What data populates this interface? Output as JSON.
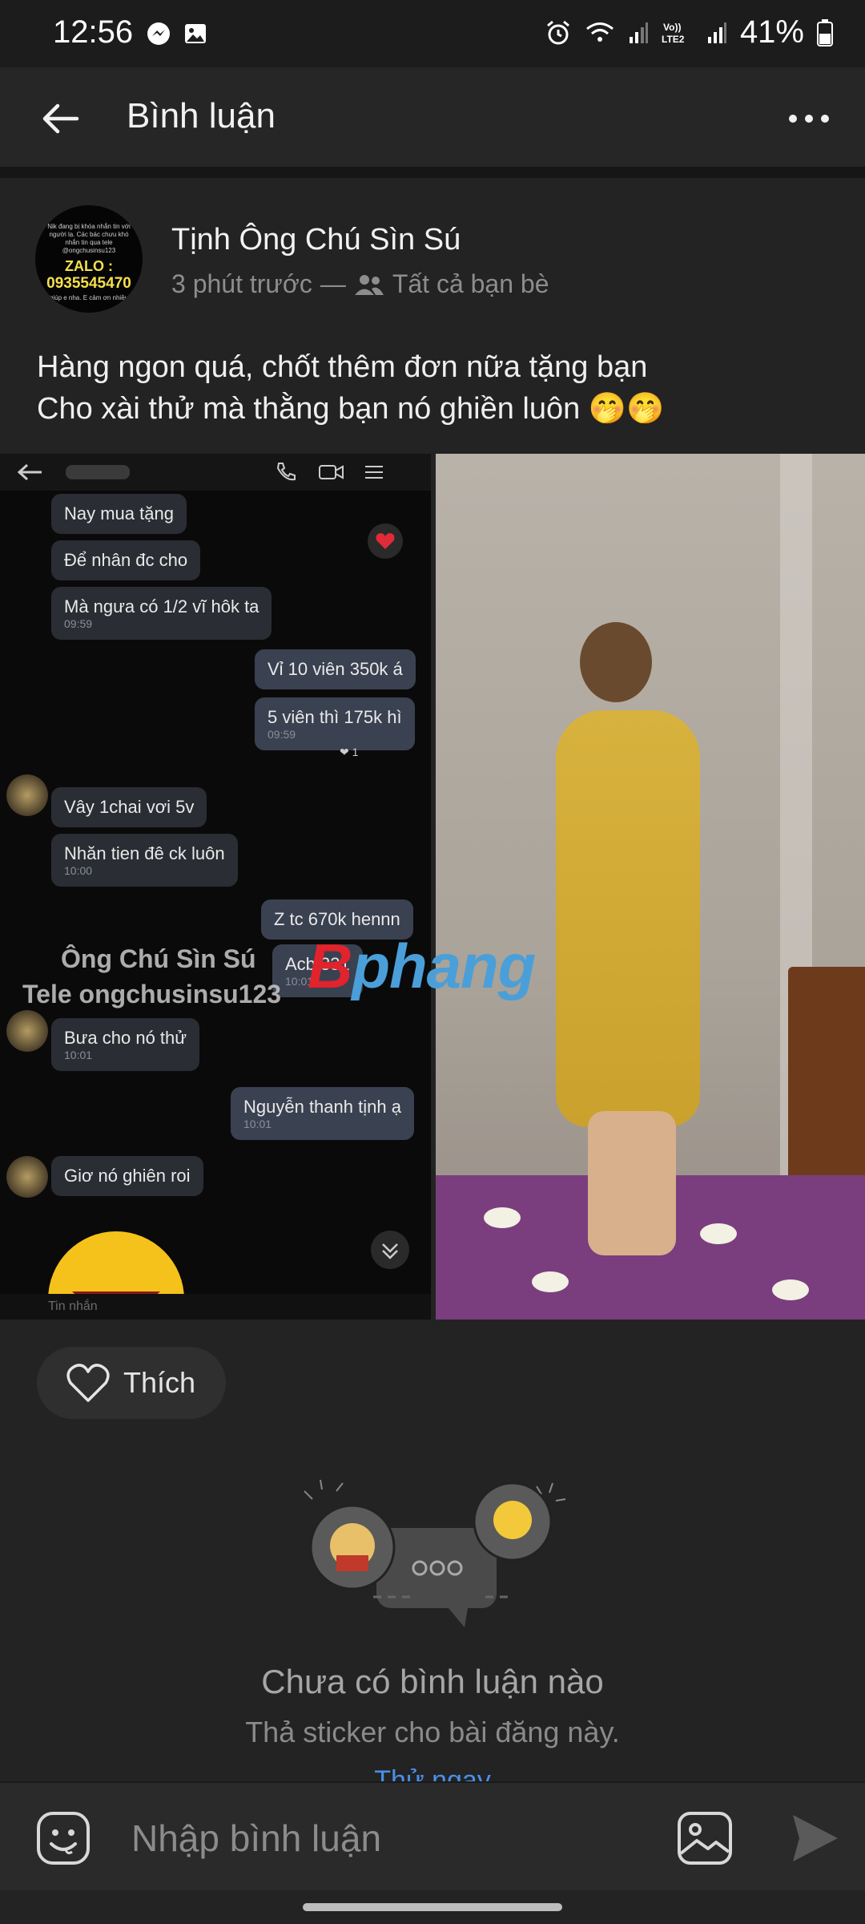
{
  "status_bar": {
    "time": "12:56",
    "battery": "41%",
    "icons": [
      "messenger-icon",
      "gallery-icon",
      "alarm-icon",
      "wifi-icon",
      "signal-icon",
      "volte-icon",
      "signal-icon",
      "battery-icon"
    ]
  },
  "appbar": {
    "title": "Bình luận"
  },
  "post": {
    "author": "Tịnh Ông Chú Sìn Sú",
    "time": "3 phút trước",
    "separator": "—",
    "audience": "Tất cả bạn bè",
    "text_line1": "Hàng ngon quá, chốt thêm đơn nữa tặng bạn",
    "text_line2": "Cho xài thử mà thằng bạn nó ghiền luôn 🤭🤭",
    "avatar": {
      "small_text": "Nik đang bị khóa nhắn tin với người lạ. Các bác chưu khó nhắn tin qua tele @ongchusinsu123",
      "zalo_label": "ZALO :",
      "phone": "0935545470",
      "footer": "giúp e nha. E cảm ơn nhiều"
    }
  },
  "chat_screenshot": {
    "messages": [
      {
        "text": "Nay mua tặng",
        "time": ""
      },
      {
        "text": "Để nhân đc cho",
        "time": ""
      },
      {
        "text": "Mà ngưa có 1/2 vĩ hôk ta",
        "time": "09:59"
      },
      {
        "text": "Vỉ 10 viên 350k á",
        "time": ""
      },
      {
        "text": "5 viên thì 175k hì",
        "time": "09:59"
      },
      {
        "text": "Vây 1chai vơi 5v",
        "time": ""
      },
      {
        "text": "Nhăn tien đê ck luôn",
        "time": "10:00"
      },
      {
        "text": "Z tc 670k hennn",
        "time": ""
      },
      {
        "text": "Acb 331",
        "time": "10:01"
      },
      {
        "text": "Bưa cho nó thử",
        "time": "10:01"
      },
      {
        "text": "Nguyễn thanh tịnh ạ",
        "time": "10:01"
      },
      {
        "text": "Giơ nó ghiên roi",
        "time": ""
      }
    ],
    "reaction_count": "1",
    "input_placeholder": "Tin nhắn",
    "watermark_line1": "Ông Chú Sìn Sú",
    "watermark_line2": "Tele ongchusinsu123"
  },
  "watermark_logo": {
    "red_part": "B",
    "blue_part": "phang"
  },
  "like_button": {
    "label": "Thích"
  },
  "empty_state": {
    "title": "Chưa có bình luận nào",
    "subtitle": "Thả sticker cho bài đăng này.",
    "action": "Thử ngay"
  },
  "composer": {
    "placeholder": "Nhập bình luận"
  },
  "colors": {
    "background": "#232323",
    "accent": "#4a8fe8",
    "zalo_yellow": "#f4e04d"
  }
}
